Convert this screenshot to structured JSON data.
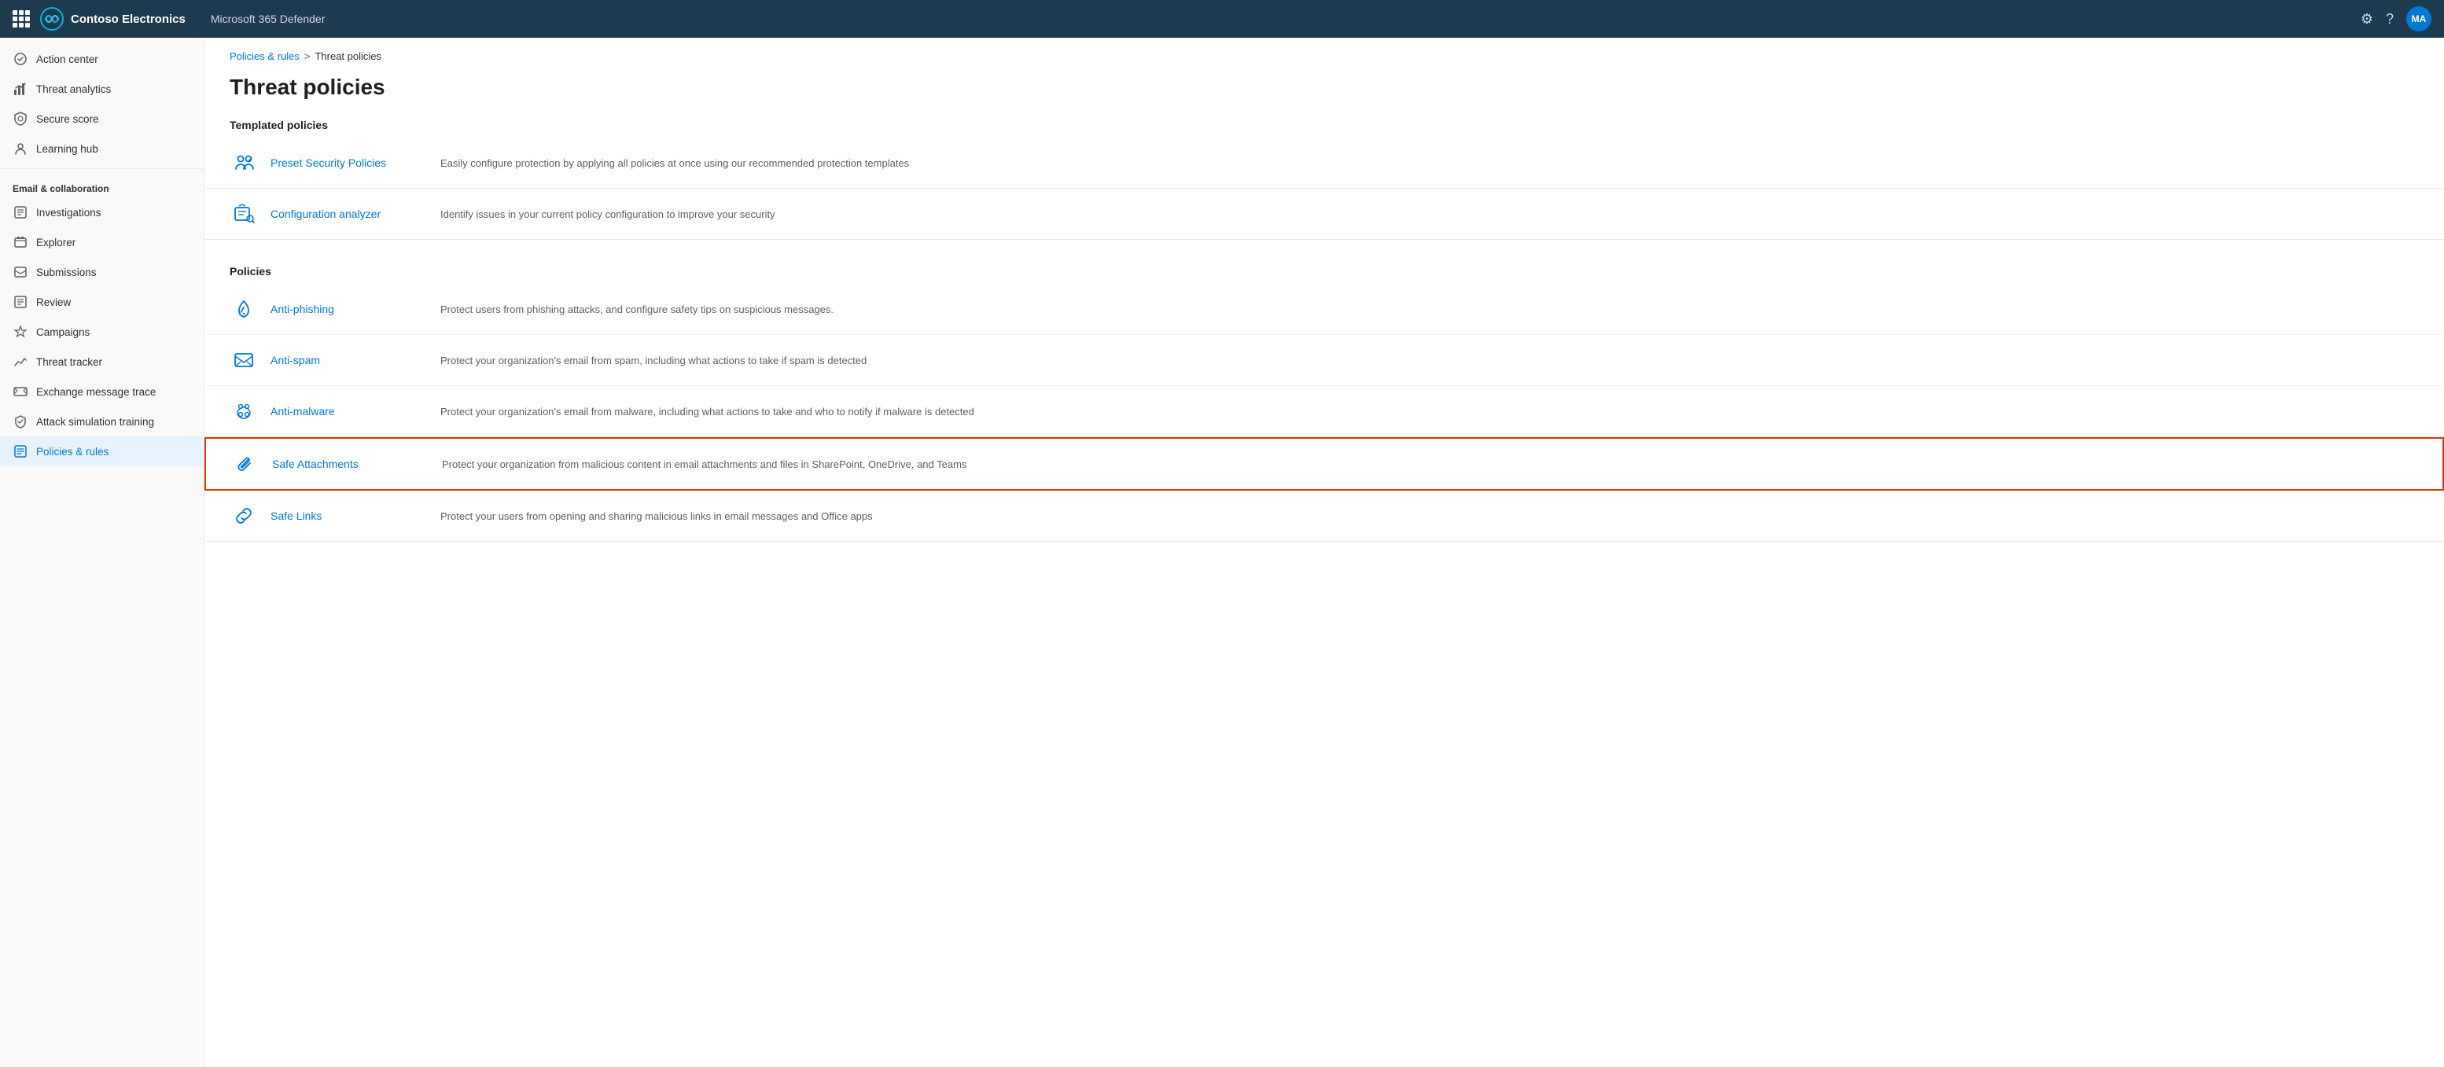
{
  "topnav": {
    "org_name": "Contoso Electronics",
    "app_name": "Microsoft 365 Defender",
    "avatar_text": "MA"
  },
  "sidebar": {
    "items_top": [
      {
        "id": "action-center",
        "label": "Action center",
        "icon": "action-center-icon"
      },
      {
        "id": "threat-analytics",
        "label": "Threat analytics",
        "icon": "threat-analytics-icon"
      },
      {
        "id": "secure-score",
        "label": "Secure score",
        "icon": "secure-score-icon"
      },
      {
        "id": "learning-hub",
        "label": "Learning hub",
        "icon": "learning-hub-icon"
      }
    ],
    "section_label": "Email & collaboration",
    "items_email": [
      {
        "id": "investigations",
        "label": "Investigations",
        "icon": "investigations-icon"
      },
      {
        "id": "explorer",
        "label": "Explorer",
        "icon": "explorer-icon"
      },
      {
        "id": "submissions",
        "label": "Submissions",
        "icon": "submissions-icon"
      },
      {
        "id": "review",
        "label": "Review",
        "icon": "review-icon"
      },
      {
        "id": "campaigns",
        "label": "Campaigns",
        "icon": "campaigns-icon"
      },
      {
        "id": "threat-tracker",
        "label": "Threat tracker",
        "icon": "threat-tracker-icon"
      },
      {
        "id": "exchange-message-trace",
        "label": "Exchange message trace",
        "icon": "exchange-icon"
      },
      {
        "id": "attack-simulation",
        "label": "Attack simulation training",
        "icon": "attack-sim-icon"
      },
      {
        "id": "policies-rules",
        "label": "Policies & rules",
        "icon": "policies-icon",
        "active": true
      }
    ]
  },
  "breadcrumb": {
    "parent": "Policies & rules",
    "separator": ">",
    "current": "Threat policies"
  },
  "page": {
    "title": "Threat policies",
    "templated_section": "Templated policies",
    "policies_section": "Policies"
  },
  "templated_policies": [
    {
      "id": "preset-security",
      "name": "Preset Security Policies",
      "description": "Easily configure protection by applying all policies at once using our recommended protection templates"
    },
    {
      "id": "config-analyzer",
      "name": "Configuration analyzer",
      "description": "Identify issues in your current policy configuration to improve your security"
    }
  ],
  "policies": [
    {
      "id": "anti-phishing",
      "name": "Anti-phishing",
      "description": "Protect users from phishing attacks, and configure safety tips on suspicious messages.",
      "highlighted": false
    },
    {
      "id": "anti-spam",
      "name": "Anti-spam",
      "description": "Protect your organization's email from spam, including what actions to take if spam is detected",
      "highlighted": false
    },
    {
      "id": "anti-malware",
      "name": "Anti-malware",
      "description": "Protect your organization's email from malware, including what actions to take and who to notify if malware is detected",
      "highlighted": false
    },
    {
      "id": "safe-attachments",
      "name": "Safe Attachments",
      "description": "Protect your organization from malicious content in email attachments and files in SharePoint, OneDrive, and Teams",
      "highlighted": true
    },
    {
      "id": "safe-links",
      "name": "Safe Links",
      "description": "Protect your users from opening and sharing malicious links in email messages and Office apps",
      "highlighted": false
    }
  ]
}
